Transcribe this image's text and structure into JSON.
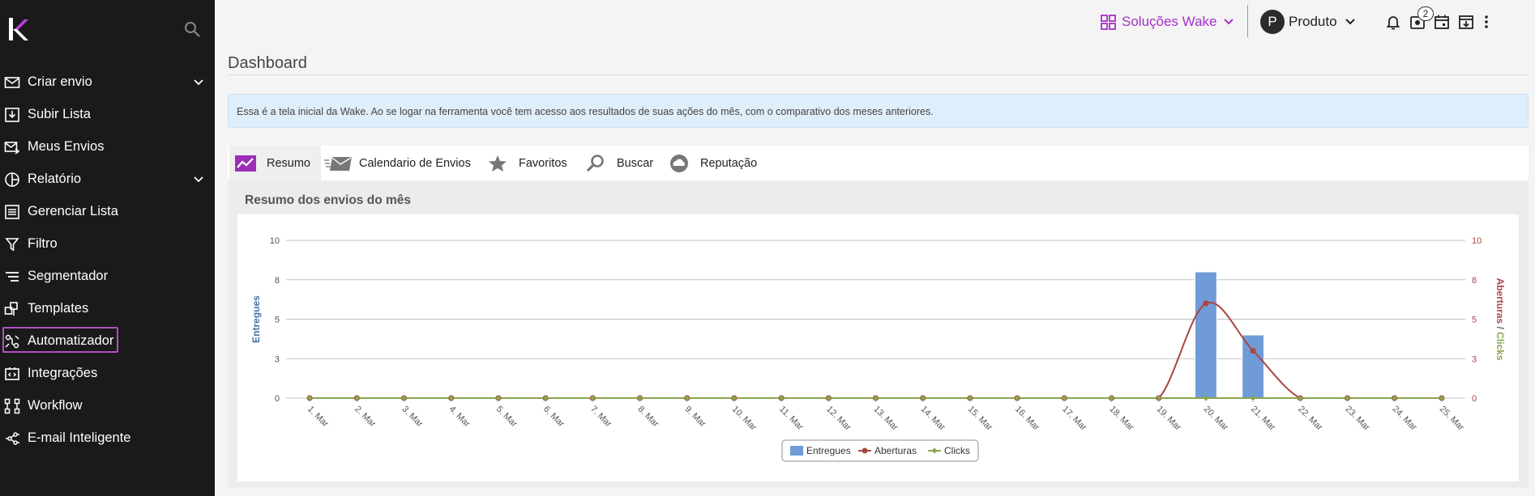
{
  "sidebar": {
    "logo": "wake-logo",
    "items": [
      {
        "label": "Criar envio",
        "icon": "mail-icon",
        "chevron": true
      },
      {
        "label": "Subir Lista",
        "icon": "upload-list-icon",
        "chevron": false
      },
      {
        "label": "Meus Envios",
        "icon": "sent-mail-icon",
        "chevron": false
      },
      {
        "label": "Relatório",
        "icon": "pie-chart-icon",
        "chevron": true
      },
      {
        "label": "Gerenciar Lista",
        "icon": "list-icon",
        "chevron": false
      },
      {
        "label": "Filtro",
        "icon": "filter-icon",
        "chevron": false
      },
      {
        "label": "Segmentador",
        "icon": "segment-icon",
        "chevron": false
      },
      {
        "label": "Templates",
        "icon": "templates-icon",
        "chevron": false
      },
      {
        "label": "Automatizador",
        "icon": "automation-icon",
        "chevron": false,
        "active": true
      },
      {
        "label": "Integrações",
        "icon": "integration-icon",
        "chevron": false
      },
      {
        "label": "Workflow",
        "icon": "workflow-icon",
        "chevron": false
      },
      {
        "label": "E-mail Inteligente",
        "icon": "brain-icon",
        "chevron": false
      }
    ]
  },
  "topbar": {
    "brand_selector": "Soluções Wake",
    "user_initial": "P",
    "user_name": "Produto",
    "notifications_badge": "2",
    "accent_color": "#a630c8"
  },
  "page": {
    "title": "Dashboard",
    "info_text": "Essa é a tela inicial da Wake. Ao se logar na ferramenta você tem acesso aos resultados de suas ações do mês, com o comparativo dos meses anteriores."
  },
  "tabs": [
    {
      "label": "Resumo",
      "icon": "trend-chart-icon",
      "active": true
    },
    {
      "label": "Calendario de Envios",
      "icon": "fast-mail-icon",
      "active": false
    },
    {
      "label": "Favoritos",
      "icon": "star-icon",
      "active": false
    },
    {
      "label": "Buscar",
      "icon": "magnifier-icon",
      "active": false
    },
    {
      "label": "Reputação",
      "icon": "cloud-face-icon",
      "active": false
    }
  ],
  "panel": {
    "title": "Resumo dos envios do mês"
  },
  "chart_data": {
    "type": "bar",
    "categories": [
      "1. Mar",
      "2. Mar",
      "3. Mar",
      "4. Mar",
      "5. Mar",
      "6. Mar",
      "7. Mar",
      "8. Mar",
      "9. Mar",
      "10. Mar",
      "11. Mar",
      "12. Mar",
      "13. Mar",
      "14. Mar",
      "15. Mar",
      "16. Mar",
      "17. Mar",
      "18. Mar",
      "19. Mar",
      "20. Mar",
      "21. Mar",
      "22. Mar",
      "23. Mar",
      "24. Mar",
      "25. Mar"
    ],
    "y_left": {
      "label": "Entregues",
      "ticks": [
        "0",
        "3",
        "5",
        "8",
        "10"
      ],
      "ylim": [
        0,
        10
      ],
      "color": "#4572a7"
    },
    "y_right": {
      "label_a": "Aberturas",
      "label_sep": "/",
      "label_b": "Clicks",
      "ticks": [
        "0",
        "3",
        "5",
        "8",
        "10"
      ],
      "ylim": [
        0,
        10
      ]
    },
    "series": [
      {
        "name": "Entregues",
        "kind": "bar",
        "color": "#6f9cd6",
        "values": [
          0,
          0,
          0,
          0,
          0,
          0,
          0,
          0,
          0,
          0,
          0,
          0,
          0,
          0,
          0,
          0,
          0,
          0,
          0,
          8,
          4,
          0,
          0,
          0,
          0
        ]
      },
      {
        "name": "Aberturas",
        "kind": "spline",
        "color": "#aa4643",
        "values": [
          0,
          0,
          0,
          0,
          0,
          0,
          0,
          0,
          0,
          0,
          0,
          0,
          0,
          0,
          0,
          0,
          0,
          0,
          0,
          6,
          3,
          0,
          0,
          0,
          0
        ]
      },
      {
        "name": "Clicks",
        "kind": "line",
        "color": "#89a54e",
        "values": [
          0,
          0,
          0,
          0,
          0,
          0,
          0,
          0,
          0,
          0,
          0,
          0,
          0,
          0,
          0,
          0,
          0,
          0,
          0,
          0,
          0,
          0,
          0,
          0,
          0
        ]
      }
    ],
    "legend": "bottom-center",
    "grid": true
  }
}
